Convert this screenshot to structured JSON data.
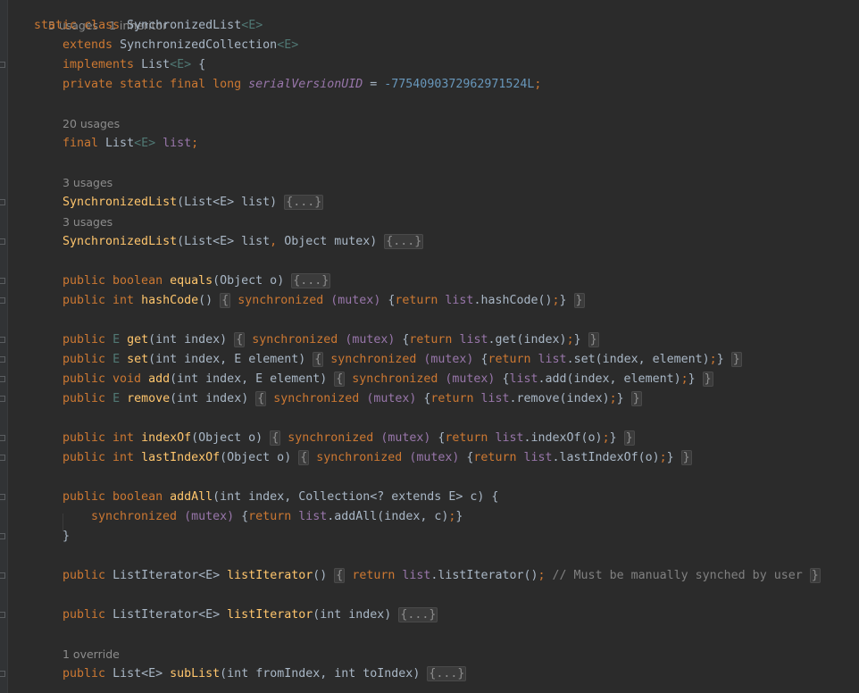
{
  "editor": {
    "hints": {
      "class_usages": "5 usages",
      "class_inheritors": "1 inheritor",
      "list_usages": "20 usages",
      "ctor1_usages": "3 usages",
      "ctor2_usages": "3 usages",
      "sublist_override": "1 override"
    },
    "code": {
      "l1_kw1": "static",
      "l1_kw2": "class",
      "l1_name": "SynchronizedList",
      "l1_generic": "<E>",
      "l2_kw": "extends",
      "l2_type": "SynchronizedCollection",
      "l2_generic": "<E>",
      "l3_kw": "implements",
      "l3_type": "List",
      "l3_generic": "<E>",
      "l3_brace": " {",
      "l4_kw": "private static final long",
      "l4_field": "serialVersionUID",
      "l4_eq": " = ",
      "l4_num": "-7754090372962971524L",
      "l4_semi": ";",
      "l6_kw": "final",
      "l6_type": "List",
      "l6_generic": "<E>",
      "l6_field": "list",
      "l6_semi": ";",
      "l8_name": "SynchronizedList",
      "l8_params": "(List<E> list)",
      "l8_fold": "{...}",
      "l10_name": "SynchronizedList",
      "l10_params_a": "(List<E> list",
      "l10_comma": ",",
      "l10_params_b": " Object mutex)",
      "l10_fold": "{...}",
      "l12_kw": "public boolean",
      "l12_name": "equals",
      "l12_params": "(Object o)",
      "l12_fold": "{...}",
      "l13_kw": "public int",
      "l13_name": "hashCode",
      "l13_params": "()",
      "l13_fold_open": "{",
      "l13_sync": "synchronized",
      "l13_mutex": "(mutex)",
      "l13_body_open": " {",
      "l13_return": "return",
      "l13_list": "list",
      "l13_call": ".hashCode()",
      "l13_semi": ";",
      "l13_body_close": "}",
      "l13_fold_close": "}",
      "l15_kw": "public",
      "l15_type": "E",
      "l15_name": "get",
      "l15_params": "(int index)",
      "l15_sync": "synchronized",
      "l15_mutex": "(mutex)",
      "l15_return": "return",
      "l15_list": "list",
      "l15_call": ".get(index)",
      "l16_kw": "public",
      "l16_type": "E",
      "l16_name": "set",
      "l16_params": "(int index, E element)",
      "l16_sync": "synchronized",
      "l16_mutex": "(mutex)",
      "l16_return": "return",
      "l16_list": "list",
      "l16_call": ".set(index, element)",
      "l17_kw": "public void",
      "l17_name": "add",
      "l17_params": "(int index, E element)",
      "l17_sync": "synchronized",
      "l17_mutex": "(mutex)",
      "l17_list": "list",
      "l17_call": ".add(index, element)",
      "l18_kw": "public",
      "l18_type": "E",
      "l18_name": "remove",
      "l18_params": "(int index)",
      "l18_sync": "synchronized",
      "l18_mutex": "(mutex)",
      "l18_return": "return",
      "l18_list": "list",
      "l18_call": ".remove(index)",
      "l20_kw": "public int",
      "l20_name": "indexOf",
      "l20_params": "(Object o)",
      "l20_sync": "synchronized",
      "l20_mutex": "(mutex)",
      "l20_return": "return",
      "l20_list": "list",
      "l20_call": ".indexOf(o)",
      "l21_kw": "public int",
      "l21_name": "lastIndexOf",
      "l21_params": "(Object o)",
      "l21_sync": "synchronized",
      "l21_mutex": "(mutex)",
      "l21_return": "return",
      "l21_list": "list",
      "l21_call": ".lastIndexOf(o)",
      "l23_kw": "public boolean",
      "l23_name": "addAll",
      "l23_params": "(int index, Collection<? extends E> c) {",
      "l24_sync": "synchronized",
      "l24_mutex": "(mutex)",
      "l24_return": "return",
      "l24_list": "list",
      "l24_call": ".addAll(index, c)",
      "l25_close": "}",
      "l27_kw": "public",
      "l27_type": "ListIterator<E>",
      "l27_name": "listIterator",
      "l27_params": "()",
      "l27_return": "return",
      "l27_list": "list",
      "l27_call": ".listIterator()",
      "l27_comment": "// Must be manually synched by user",
      "l29_kw": "public",
      "l29_type": "ListIterator<E>",
      "l29_name": "listIterator",
      "l29_params": "(int index)",
      "l29_fold": "{...}",
      "l31_kw": "public",
      "l31_type": "List<E>",
      "l31_name": "subList",
      "l31_params": "(int fromIndex, int toIndex)",
      "l31_fold": "{...}"
    }
  },
  "colors": {
    "background": "#2b2b2b",
    "keyword": "#cc7832",
    "method": "#ffc66d",
    "field": "#9876aa",
    "number": "#6897bb",
    "comment": "#808080",
    "text": "#a9b7c6"
  }
}
